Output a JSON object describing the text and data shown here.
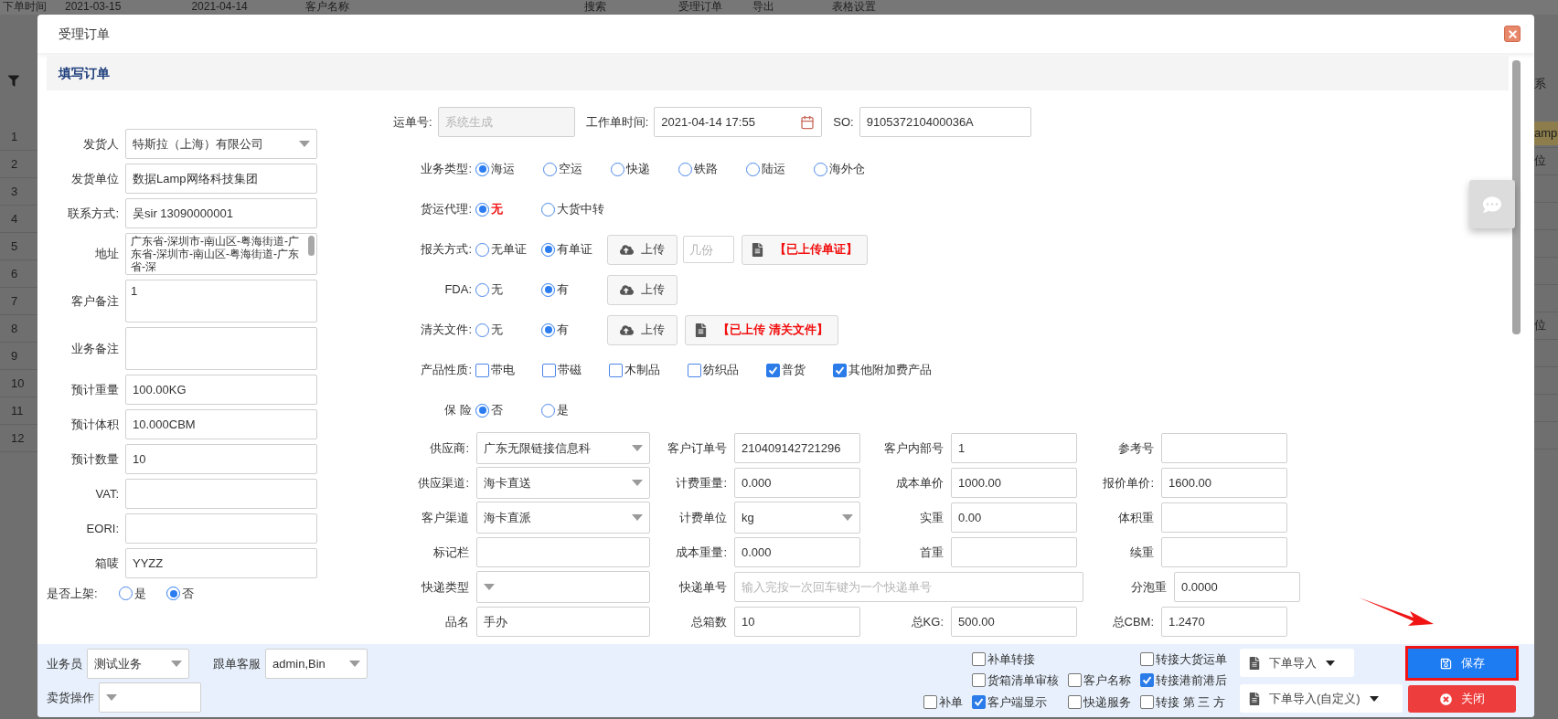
{
  "background": {
    "toolbar": [
      "下单时间",
      "2021-03-15",
      "2021-04-14",
      "客户名称",
      "搜索",
      "受理订单",
      "导出",
      "表格设置"
    ],
    "row_numbers": [
      "1",
      "2",
      "3",
      "4",
      "5",
      "6",
      "7",
      "8",
      "9",
      "10",
      "11",
      "12"
    ],
    "right_header": "系",
    "right_cells": [
      {
        "text": "amp",
        "selected": true
      },
      {
        "text": "位",
        "selected": false
      },
      {
        "text": "位",
        "selected": false
      }
    ]
  },
  "dialog": {
    "title": "受理订单",
    "section": "填写订单",
    "left_fields": [
      {
        "label": "发货人",
        "value": "特斯拉（上海）有限公司",
        "kind": "select"
      },
      {
        "label": "发货单位",
        "value": "数据Lamp网络科技集团",
        "kind": "input"
      },
      {
        "label": "联系方式:",
        "value": "吴sir 13090000001",
        "kind": "input"
      },
      {
        "label": "地址",
        "value": "广东省-深圳市-南山区-粤海街道-广东省-深圳市-南山区-粤海街道-广东省-深",
        "kind": "address"
      },
      {
        "label": "客户备注",
        "value": "1",
        "kind": "textarea"
      },
      {
        "label": "业务备注",
        "kind": "textarea"
      },
      {
        "label": "预计重量",
        "value": "100.00KG",
        "kind": "input"
      },
      {
        "label": "预计体积",
        "value": "10.000CBM",
        "kind": "input"
      },
      {
        "label": "预计数量",
        "value": "10",
        "kind": "input"
      },
      {
        "label": "VAT:",
        "kind": "input"
      },
      {
        "label": "EORI:",
        "kind": "input"
      },
      {
        "label": "箱唛",
        "value": "YYZZ",
        "kind": "input"
      }
    ],
    "shelving": {
      "label": "是否上架:",
      "options": [
        {
          "label": "是",
          "selected": false
        },
        {
          "label": "否",
          "selected": true
        }
      ]
    },
    "header_fields": [
      {
        "label": "运单号:",
        "placeholder": "系统生成",
        "kind": "disabled"
      },
      {
        "label": "工作单时间:",
        "value": "2021-04-14 17:55",
        "kind": "date"
      },
      {
        "label": "SO:",
        "value": "910537210400036A",
        "kind": "input"
      }
    ],
    "option_rows": [
      {
        "label": "业务类型:",
        "kind": "radio",
        "options": [
          {
            "label": "海运",
            "selected": true
          },
          {
            "label": "空运",
            "selected": false
          },
          {
            "label": "快递",
            "selected": false
          },
          {
            "label": "铁路",
            "selected": false
          },
          {
            "label": "陆运",
            "selected": false
          },
          {
            "label": "海外仓",
            "selected": false
          }
        ]
      },
      {
        "label": "货运代理:",
        "kind": "radio",
        "options": [
          {
            "label": "无",
            "selected": true,
            "emphasis": true
          },
          {
            "label": "大货中转",
            "selected": false,
            "emphasis": false
          }
        ]
      },
      {
        "label": "报关方式:",
        "kind": "radio",
        "options": [
          {
            "label": "无单证",
            "selected": false
          },
          {
            "label": "有单证",
            "selected": true
          }
        ],
        "actions": [
          {
            "kind": "upload",
            "label": "上传"
          },
          {
            "kind": "count",
            "placeholder": "几份"
          },
          {
            "kind": "uploaded",
            "label": "【已上传单证】"
          }
        ]
      },
      {
        "label": "FDA:",
        "kind": "radio",
        "options": [
          {
            "label": "无",
            "selected": false
          },
          {
            "label": "有",
            "selected": true
          }
        ],
        "actions": [
          {
            "kind": "upload",
            "label": "上传"
          }
        ]
      },
      {
        "label": "清关文件:",
        "kind": "radio",
        "options": [
          {
            "label": "无",
            "selected": false
          },
          {
            "label": "有",
            "selected": true
          }
        ],
        "actions": [
          {
            "kind": "upload",
            "label": "上传"
          },
          {
            "kind": "uploaded",
            "label": "【已上传 清关文件】"
          }
        ]
      },
      {
        "label": "产品性质:",
        "kind": "checkbox",
        "options": [
          {
            "label": "带电",
            "checked": false
          },
          {
            "label": "带磁",
            "checked": false
          },
          {
            "label": "木制品",
            "checked": false
          },
          {
            "label": "纺织品",
            "checked": false
          },
          {
            "label": "普货",
            "checked": true
          },
          {
            "label": "其他附加费产品",
            "checked": true
          }
        ]
      },
      {
        "label": "保 险",
        "kind": "radio",
        "options": [
          {
            "label": "否",
            "selected": true
          },
          {
            "label": "是",
            "selected": false
          }
        ]
      }
    ],
    "grid_rows": [
      [
        {
          "label": "供应商:",
          "value": "广东无限链接信息科",
          "kind": "select"
        },
        {
          "label": "客户订单号",
          "value": "210409142721296",
          "kind": "input"
        },
        {
          "label": "客户内部号",
          "value": "1",
          "kind": "input"
        },
        {
          "label": "参考号",
          "kind": "input"
        }
      ],
      [
        {
          "label": "供应渠道:",
          "value": "海卡直送",
          "kind": "select"
        },
        {
          "label": "计费重量:",
          "value": "0.000",
          "kind": "input"
        },
        {
          "label": "成本单价",
          "value": "1000.00",
          "kind": "input"
        },
        {
          "label": "报价单价:",
          "value": "1600.00",
          "kind": "input"
        }
      ],
      [
        {
          "label": "客户渠道",
          "value": "海卡直派",
          "kind": "select"
        },
        {
          "label": "计费单位",
          "value": "kg",
          "kind": "select"
        },
        {
          "label": "实重",
          "value": "0.00",
          "kind": "input"
        },
        {
          "label": "体积重",
          "kind": "input"
        }
      ],
      [
        {
          "label": "标记栏",
          "kind": "input"
        },
        {
          "label": "成本重量:",
          "value": "0.000",
          "kind": "input"
        },
        {
          "label": "首重",
          "kind": "input"
        },
        {
          "label": "续重",
          "kind": "input"
        }
      ],
      [
        {
          "label": "快递类型",
          "kind": "select"
        },
        {
          "label": "快递单号",
          "placeholder": "输入完按一次回车键为一个快递单号",
          "kind": "wide"
        },
        {
          "label": "分泡重",
          "value": "0.0000",
          "kind": "input"
        }
      ],
      [
        {
          "label": "品名",
          "value": "手办",
          "kind": "input"
        },
        {
          "label": "总箱数",
          "value": "10",
          "kind": "input"
        },
        {
          "label": "总KG:",
          "value": "500.00",
          "kind": "input"
        },
        {
          "label": "总CBM:",
          "value": "1.2470",
          "kind": "input"
        }
      ]
    ]
  },
  "footer": {
    "select_rows": [
      [
        {
          "label": "业务员",
          "value": "测试业务"
        },
        {
          "label": "跟单客服",
          "value": "admin,Bin"
        }
      ],
      [
        {
          "label": "卖货操作"
        }
      ]
    ],
    "checkbox_columns": [
      [
        {
          "label": "补单",
          "checked": false
        }
      ],
      [
        {
          "label": "补单转接",
          "checked": false
        },
        {
          "label": "货箱清单审核",
          "checked": false
        },
        {
          "label": "客户端显示",
          "checked": true
        }
      ],
      [
        {
          "label": "客户名称",
          "checked": false
        },
        {
          "label": "快递服务",
          "checked": false
        }
      ],
      [
        {
          "label": "转接大货运单",
          "checked": false
        },
        {
          "label": "转接港前港后",
          "checked": true
        },
        {
          "label": "转接 第 三 方",
          "checked": false
        }
      ]
    ],
    "imports": [
      "下单导入",
      "下单导入(自定义)"
    ],
    "save": "保存",
    "close": "关闭"
  }
}
